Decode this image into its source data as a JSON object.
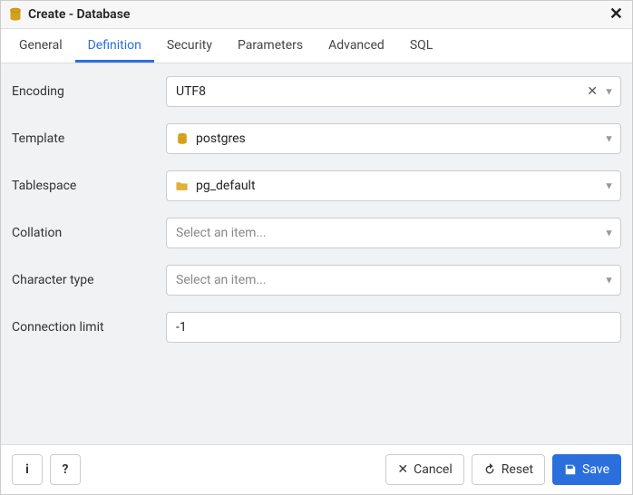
{
  "titlebar": {
    "title": "Create - Database"
  },
  "tabs": [
    {
      "label": "General"
    },
    {
      "label": "Definition"
    },
    {
      "label": "Security"
    },
    {
      "label": "Parameters"
    },
    {
      "label": "Advanced"
    },
    {
      "label": "SQL"
    }
  ],
  "active_tab_index": 1,
  "form": {
    "encoding": {
      "label": "Encoding",
      "value": "UTF8",
      "placeholder": ""
    },
    "template": {
      "label": "Template",
      "value": "postgres",
      "placeholder": ""
    },
    "tablespace": {
      "label": "Tablespace",
      "value": "pg_default",
      "placeholder": ""
    },
    "collation": {
      "label": "Collation",
      "value": "",
      "placeholder": "Select an item..."
    },
    "character_type": {
      "label": "Character type",
      "value": "",
      "placeholder": "Select an item..."
    },
    "connection_limit": {
      "label": "Connection limit",
      "value": "-1",
      "placeholder": ""
    }
  },
  "footer": {
    "cancel": "Cancel",
    "reset": "Reset",
    "save": "Save"
  },
  "icons": {
    "database": "database-icon",
    "folder": "folder-icon",
    "close": "close-icon",
    "info": "info-icon",
    "help": "help-icon",
    "reset": "reset-icon",
    "save": "save-icon"
  },
  "colors": {
    "accent": "#2b6fdc",
    "db_gold": "#d4a017",
    "folder_gold": "#e2b03a"
  }
}
